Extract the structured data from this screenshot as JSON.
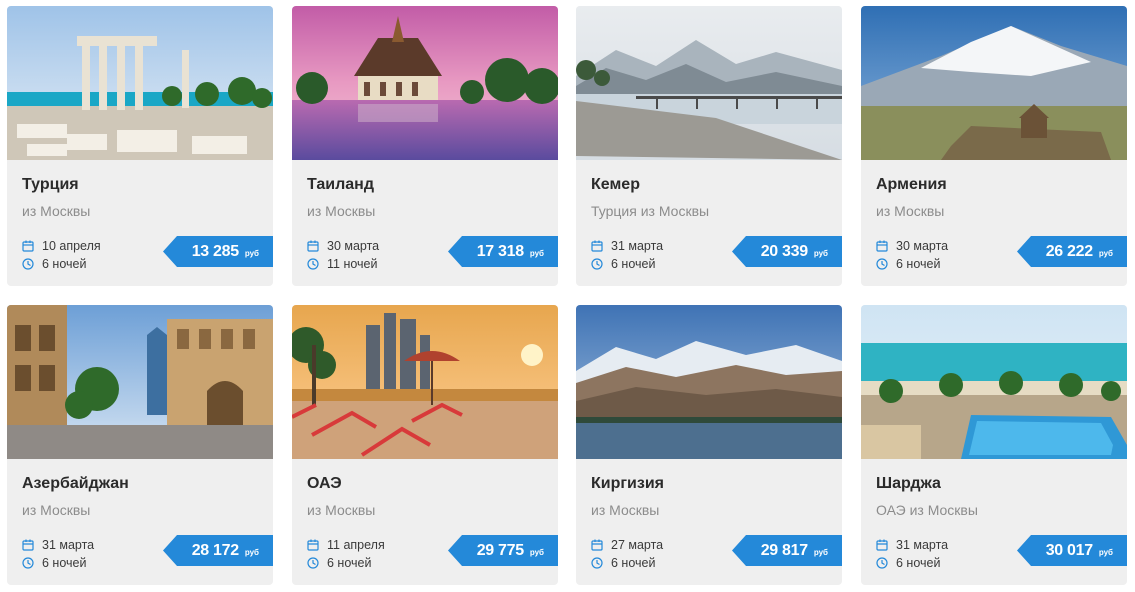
{
  "colors": {
    "accent": "#2489d9",
    "card_bg": "#efefef",
    "title": "#2b2b2b",
    "subtitle": "#8c8c8c",
    "icon": "#2489d9"
  },
  "icons": {
    "date": "calendar-icon",
    "nights": "clock-icon"
  },
  "cards": [
    {
      "title": "Турция",
      "subtitle": "из Москвы",
      "date": "10 апреля",
      "nights": "6 ночей",
      "price": "13 285",
      "currency": "руб"
    },
    {
      "title": "Таиланд",
      "subtitle": "из Москвы",
      "date": "30 марта",
      "nights": "11 ночей",
      "price": "17 318",
      "currency": "руб"
    },
    {
      "title": "Кемер",
      "subtitle": "Турция из Москвы",
      "date": "31 марта",
      "nights": "6 ночей",
      "price": "20 339",
      "currency": "руб"
    },
    {
      "title": "Армения",
      "subtitle": "из Москвы",
      "date": "30 марта",
      "nights": "6 ночей",
      "price": "26 222",
      "currency": "руб"
    },
    {
      "title": "Азербайджан",
      "subtitle": "из Москвы",
      "date": "31 марта",
      "nights": "6 ночей",
      "price": "28 172",
      "currency": "руб"
    },
    {
      "title": "ОАЭ",
      "subtitle": "из Москвы",
      "date": "11 апреля",
      "nights": "6 ночей",
      "price": "29 775",
      "currency": "руб"
    },
    {
      "title": "Киргизия",
      "subtitle": "из Москвы",
      "date": "27 марта",
      "nights": "6 ночей",
      "price": "29 817",
      "currency": "руб"
    },
    {
      "title": "Шарджа",
      "subtitle": "ОАЭ из Москвы",
      "date": "31 марта",
      "nights": "6 ночей",
      "price": "30 017",
      "currency": "руб"
    }
  ]
}
